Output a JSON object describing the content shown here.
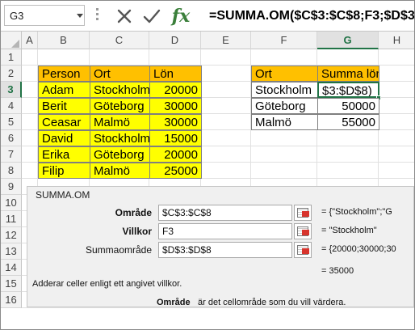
{
  "formula_bar": {
    "name_box": "G3",
    "cancel_icon": "close-icon",
    "enter_icon": "checkmark-icon",
    "fx_label": "fx",
    "formula": "=SUMMA.OM($C$3:$C$8;F3;$D$3:$D$8)"
  },
  "columns": [
    "A",
    "B",
    "C",
    "D",
    "E",
    "F",
    "G",
    "H"
  ],
  "rows": [
    "1",
    "2",
    "3",
    "4",
    "5",
    "6",
    "7",
    "8",
    "9",
    "10",
    "11",
    "12",
    "13",
    "14",
    "15",
    "16"
  ],
  "table1": {
    "headers": [
      "Person",
      "Ort",
      "Lön"
    ],
    "rows": [
      [
        "Adam",
        "Stockholm",
        "20000"
      ],
      [
        "Berit",
        "Göteborg",
        "30000"
      ],
      [
        "Ceasar",
        "Malmö",
        "30000"
      ],
      [
        "David",
        "Stockholm",
        "15000"
      ],
      [
        "Erika",
        "Göteborg",
        "20000"
      ],
      [
        "Filip",
        "Malmö",
        "25000"
      ]
    ]
  },
  "table2": {
    "headers": [
      "Ort",
      "Summa lön"
    ],
    "rows": [
      [
        "Stockholm",
        "$3:$D$8)"
      ],
      [
        "Göteborg",
        "50000"
      ],
      [
        "Malmö",
        "55000"
      ]
    ]
  },
  "dialog": {
    "title": "SUMMA.OM",
    "args": [
      {
        "label": "Område",
        "value": "$C$3:$C$8",
        "result": "=  {\"Stockholm\";\"G"
      },
      {
        "label": "Villkor",
        "value": "F3",
        "result": "=  \"Stockholm\""
      },
      {
        "label": "Summaområde",
        "value": "$D$3:$D$8",
        "result": "=  {20000;30000;30"
      }
    ],
    "total": "=  35000",
    "description": "Adderar celler enligt ett angivet villkor.",
    "help_label": "Område",
    "help_text": "är det cellområde som du vill värdera."
  },
  "colors": {
    "header_fill": "#ffc000",
    "data_fill": "#ffff00",
    "selection": "#217346"
  }
}
